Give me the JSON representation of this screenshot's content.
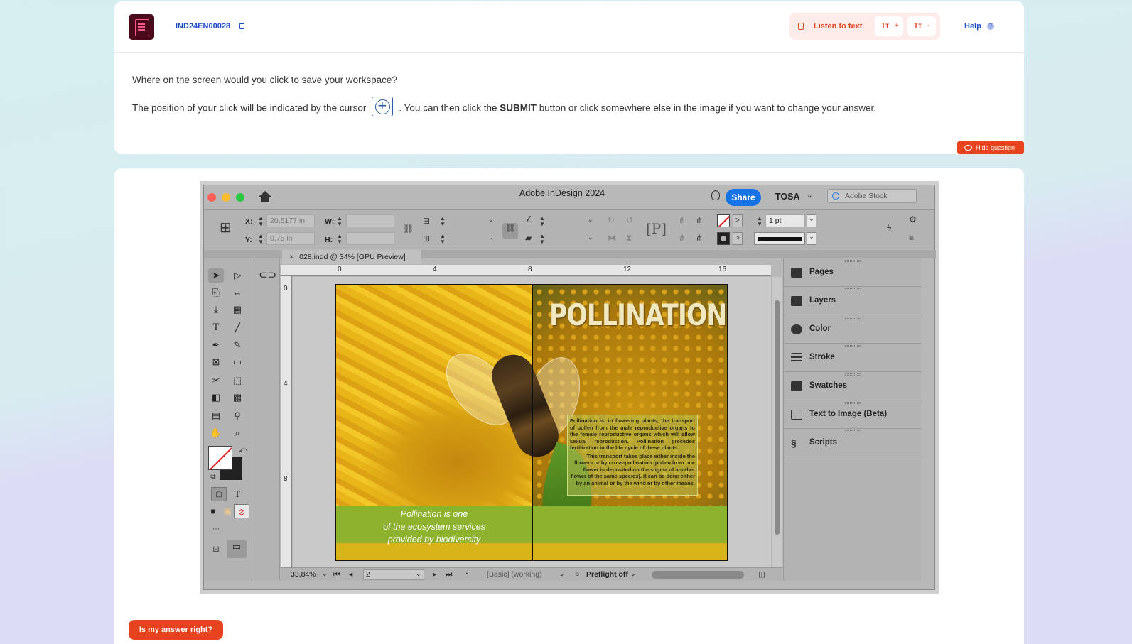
{
  "header": {
    "question_id": "IND24EN00028",
    "listen_label": "Listen to text",
    "text_size_increase": {
      "icon": "Tт",
      "sign": "+"
    },
    "text_size_decrease": {
      "icon": "Tт",
      "sign": "-"
    },
    "help_label": "Help",
    "help_icon": "?"
  },
  "question": {
    "text": "Where on the screen would you click to save your workspace?",
    "instruction_before": "The position of your click will be indicated by the cursor",
    "instruction_after_1": ". You can then click the ",
    "instruction_bold": "SUBMIT",
    "instruction_after_2": " button or click somewhere else in the image if you want to change your answer.",
    "hide_label": "Hide question"
  },
  "footer": {
    "answer_button": "Is my answer right?"
  },
  "app": {
    "title": "Adobe InDesign 2024",
    "share_label": "Share",
    "workspace": "TOSA",
    "stock_placeholder": "Adobe Stock",
    "control": {
      "x_label": "X:",
      "x_value": "20,5177 in",
      "y_label": "Y:",
      "y_value": "0,75 in",
      "w_label": "W:",
      "h_label": "H:",
      "stroke_weight": "1 pt"
    },
    "doc_tab": "028.indd @ 34% [GPU Preview]",
    "ruler_h": [
      "0",
      "4",
      "8",
      "12",
      "16"
    ],
    "ruler_v": [
      "0",
      "4",
      "8"
    ],
    "status": {
      "zoom": "33,84%",
      "page": "2",
      "profile": "[Basic] (working)",
      "preflight": "Preflight off"
    },
    "panels": [
      "Pages",
      "Layers",
      "Color",
      "Stroke",
      "Swatches",
      "Text to Image (Beta)",
      "Scripts"
    ],
    "document": {
      "title": "POLLINATION",
      "tagline": [
        "Pollination is one",
        "of the ecosystem services",
        "provided by biodiversity"
      ],
      "body_1": "Pollination is, in flowering plants, the transport of pollen from the male reproductive organs to the female reproductive organs which will allow sexual reproduction. Pollination precedes fertilization in the life cycle of these plants.",
      "body_2": "This transport takes place either inside the flowers or by cross-pollination (pollen from one flower is deposited on the stigma of another flower of the same species). It can be done either by an animal or by the wind or by other means."
    }
  },
  "colors": {
    "accent": "#e8431f",
    "link": "#1e4fc8",
    "share": "#1473e6"
  }
}
